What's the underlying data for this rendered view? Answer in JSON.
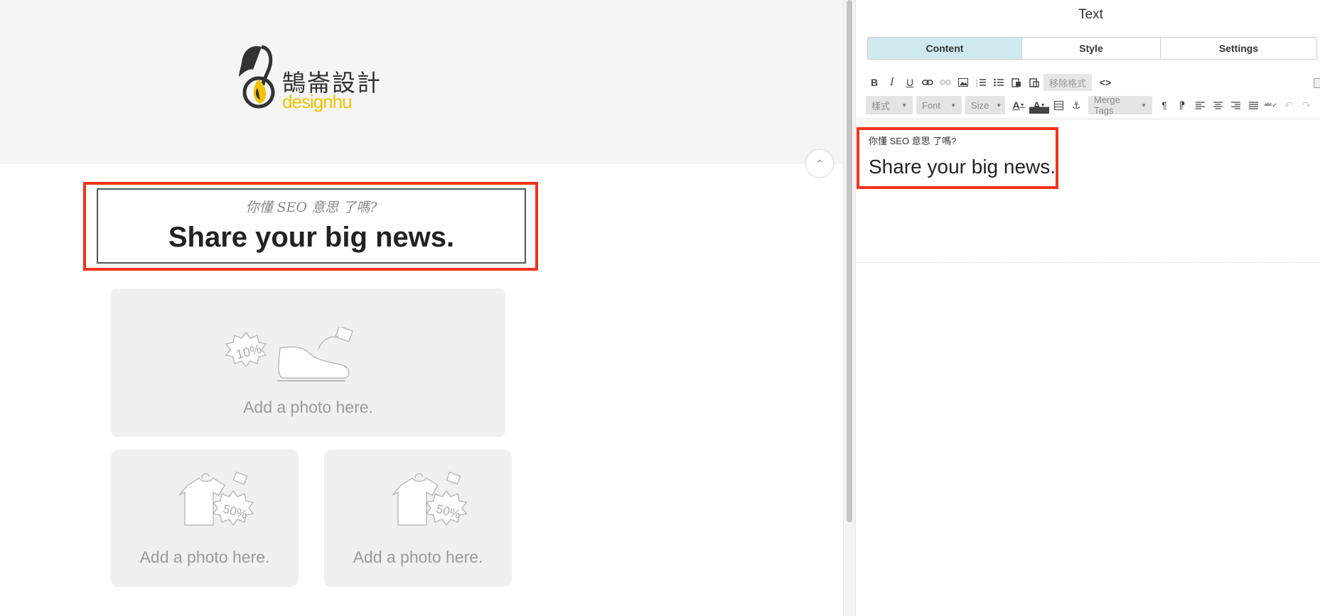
{
  "canvas": {
    "logo": {
      "chinese": "鵠崙設計",
      "english": "designhu"
    },
    "text_block": {
      "subtitle": "你懂 SEO 意思 了嗎?",
      "headline": "Share your big news."
    },
    "photos": [
      {
        "label": "Add a photo here.",
        "tag": "10%"
      },
      {
        "label": "Add a photo here.",
        "tag": "50%"
      },
      {
        "label": "Add a photo here.",
        "tag": "50%"
      }
    ]
  },
  "panel": {
    "title": "Text",
    "tabs": [
      {
        "label": "Content",
        "active": true
      },
      {
        "label": "Style",
        "active": false
      },
      {
        "label": "Settings",
        "active": false
      }
    ],
    "toolbar": {
      "remove_format_label": "移除格式",
      "styles_label": "樣式",
      "font_label": "Font",
      "size_label": "Size",
      "merge_tags_label": "Merge Tags"
    },
    "editor": {
      "subtitle": "你懂 SEO 意思 了嗎?",
      "headline": "Share your big news."
    }
  },
  "colors": {
    "highlight": "#f2331b",
    "active_tab": "#cfe9f1",
    "logo_yellow": "#f2c200"
  }
}
